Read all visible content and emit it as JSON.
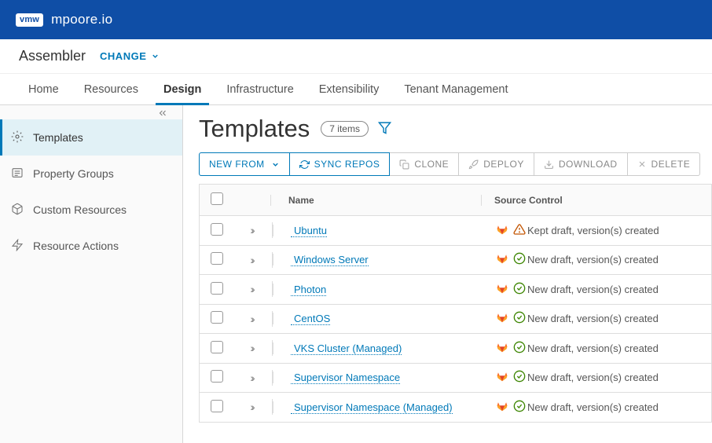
{
  "header": {
    "logo_text": "vmw",
    "site_title": "mpoore.io"
  },
  "appbar": {
    "app_name": "Assembler",
    "change_label": "CHANGE"
  },
  "tabs": [
    {
      "label": "Home",
      "active": false
    },
    {
      "label": "Resources",
      "active": false
    },
    {
      "label": "Design",
      "active": true
    },
    {
      "label": "Infrastructure",
      "active": false
    },
    {
      "label": "Extensibility",
      "active": false
    },
    {
      "label": "Tenant Management",
      "active": false
    }
  ],
  "sidebar": [
    {
      "label": "Templates",
      "icon": "wrench-icon",
      "active": true
    },
    {
      "label": "Property Groups",
      "icon": "list-icon",
      "active": false
    },
    {
      "label": "Custom Resources",
      "icon": "cube-icon",
      "active": false
    },
    {
      "label": "Resource Actions",
      "icon": "bolt-icon",
      "active": false
    }
  ],
  "page": {
    "title": "Templates",
    "item_count_label": "7 items"
  },
  "toolbar": {
    "new_from": "NEW FROM",
    "sync_repos": "SYNC REPOS",
    "clone": "CLONE",
    "deploy": "DEPLOY",
    "download": "DOWNLOAD",
    "delete": "DELETE"
  },
  "table": {
    "headers": {
      "name": "Name",
      "source": "Source Control"
    },
    "rows": [
      {
        "name": "Ubuntu",
        "status": "warn",
        "status_text": "Kept draft, version(s) created"
      },
      {
        "name": "Windows Server",
        "status": "ok",
        "status_text": "New draft, version(s) created"
      },
      {
        "name": "Photon",
        "status": "ok",
        "status_text": "New draft, version(s) created"
      },
      {
        "name": "CentOS",
        "status": "ok",
        "status_text": "New draft, version(s) created"
      },
      {
        "name": "VKS Cluster (Managed)",
        "status": "ok",
        "status_text": "New draft, version(s) created"
      },
      {
        "name": "Supervisor Namespace",
        "status": "ok",
        "status_text": "New draft, version(s) created"
      },
      {
        "name": "Supervisor Namespace (Managed)",
        "status": "ok",
        "status_text": "New draft, version(s) created"
      }
    ]
  }
}
